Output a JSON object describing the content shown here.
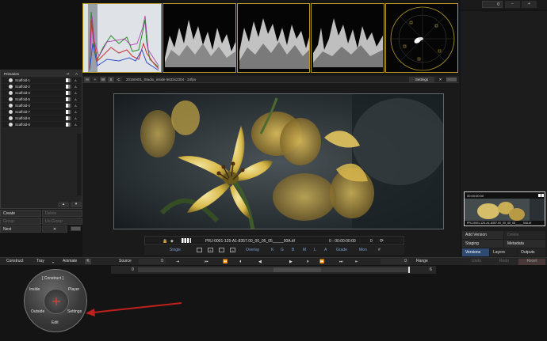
{
  "top_right": {
    "frame_field": "0",
    "minus": "−",
    "plus": "+"
  },
  "left_panel": {
    "header": "Primaries",
    "header_lock": "A",
    "groups": [
      "Scaffold-1",
      "Scaffold-2",
      "Scaffold-3",
      "Scaffold-5",
      "Scaffold-4",
      "Scaffold-7",
      "Scaffold-6",
      "Scaffold-8"
    ],
    "lock_label": "A",
    "create": "Create",
    "delete": "Delete",
    "group": "Group",
    "ungroup": "Un-Group",
    "next": "Next",
    "next_x": "✕"
  },
  "viewer": {
    "btn_h": "H",
    "btn_plus": "+",
    "btn_w": "W",
    "btn_s": "S",
    "btn_c": "C",
    "clip_info": "20150401_Studio_inside 5632x2304 · 24fps",
    "settings": "Settings",
    "close": "✕"
  },
  "transport": {
    "filename": "PRJ-0001-125-A1-8357.00_00_05_05_____00A.tif",
    "timecode": "0 - 00:00:00:00",
    "frame": "0"
  },
  "modebar": {
    "single": "Single",
    "overlay": "Overlay",
    "channels": [
      "K",
      "G",
      "B",
      "M",
      "L",
      "A"
    ],
    "grade": "Grade",
    "mon": "Mon",
    "grid": "#"
  },
  "right_panel": {
    "thumb_tc": "00:00:00:00",
    "thumb_name": "PRJ-0001-125-A1-8357.00_00_05_05_____00A.tif",
    "add_version": "Add Version",
    "delete": "Delete",
    "staging": "Staging",
    "metadata": "Metadata",
    "tabs": [
      "Versions",
      "Layers",
      "Outputs"
    ]
  },
  "bottom_bar": {
    "construct": "Construct",
    "tray": "Tray",
    "animate": "Animate",
    "k": "K",
    "source": "Source",
    "source_val": "0",
    "range_val": "0",
    "range": "Range",
    "undo": "Undo",
    "redo": "Redo",
    "reset": "Reset",
    "timeline_start": "0",
    "timeline_end": "6"
  },
  "radial_menu": {
    "title": "[ Construct ]",
    "top_left": "Inside",
    "top_right": "Player",
    "bottom_left": "Outside",
    "bottom_right": "Settings",
    "bottom": "Edit"
  },
  "colors": {
    "accent": "#b49b2a",
    "annotation_arrow": "#c0201c",
    "selected_tab": "#2e4a72"
  }
}
